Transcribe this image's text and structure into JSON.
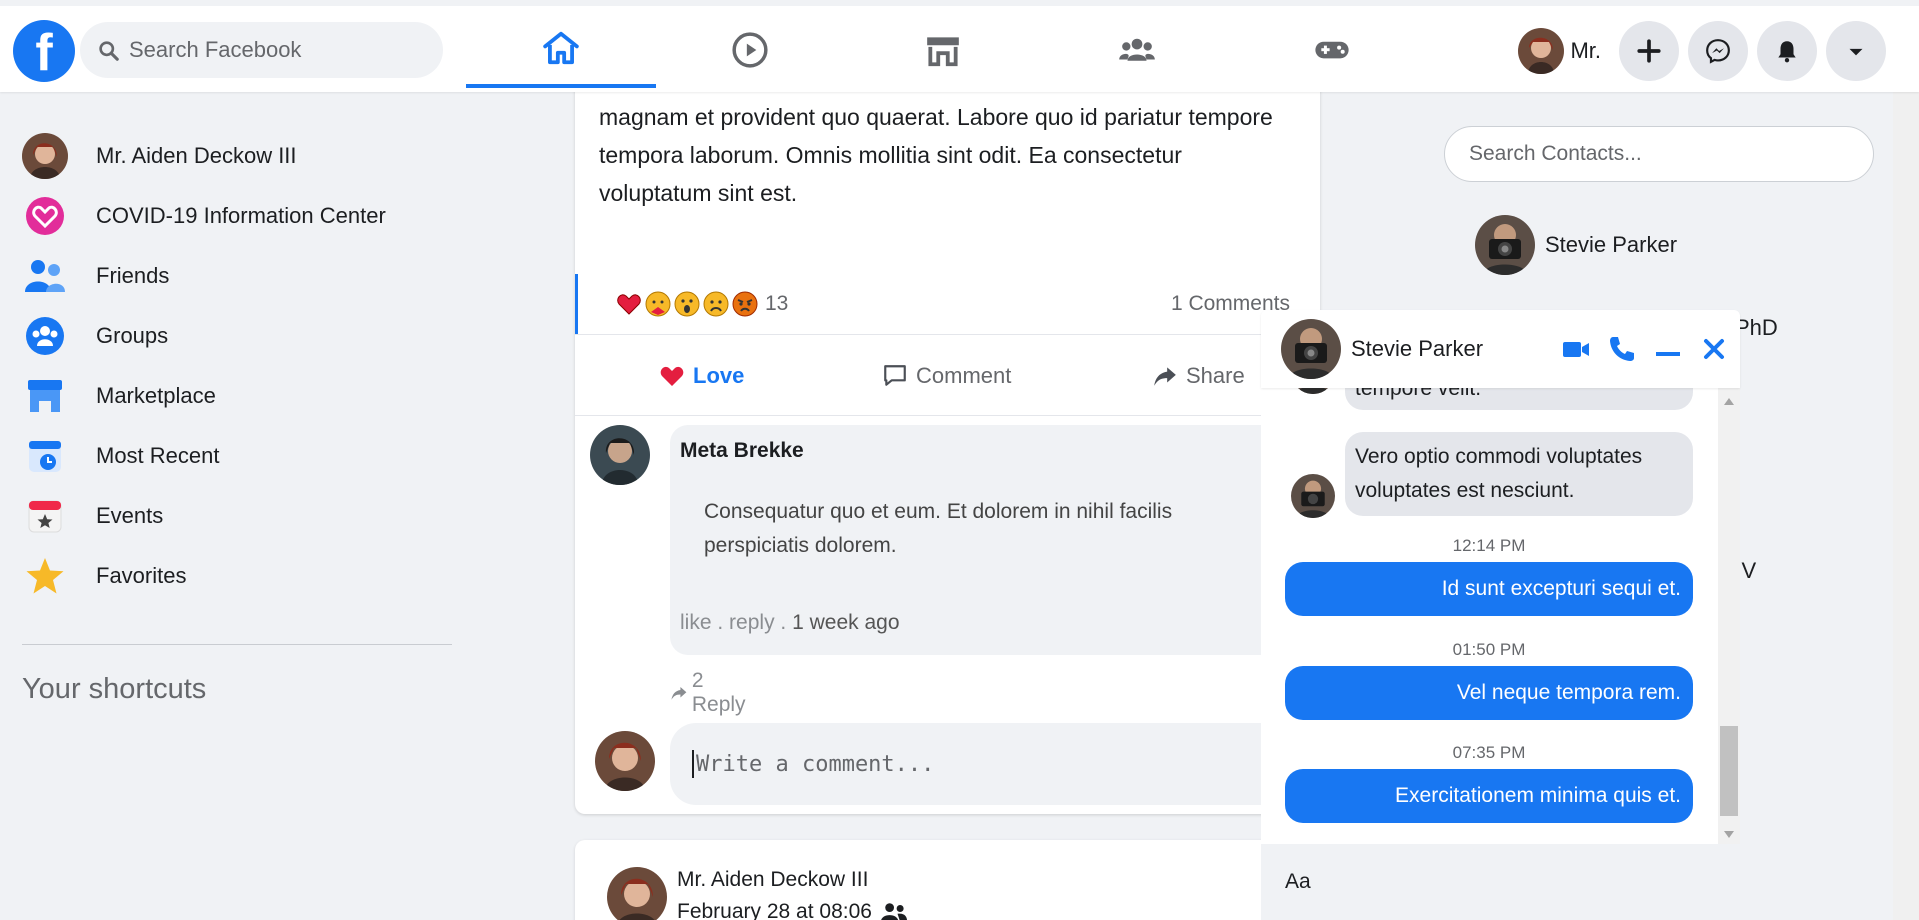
{
  "topbar": {
    "logo_letter": "f",
    "search_placeholder": "Search Facebook",
    "profile_name": "Mr.",
    "nav_tabs": [
      "home-icon",
      "watch-icon",
      "marketplace-icon",
      "groups-icon",
      "gaming-icon"
    ],
    "active_tab": "home",
    "accent_color": "#1877f2"
  },
  "sidebar": {
    "items": [
      {
        "label": "Mr. Aiden Deckow III",
        "icon": "avatar"
      },
      {
        "label": "COVID-19 Information Center",
        "icon": "covid-heart-icon"
      },
      {
        "label": "Friends",
        "icon": "friends-icon"
      },
      {
        "label": "Groups",
        "icon": "groups-icon"
      },
      {
        "label": "Marketplace",
        "icon": "marketplace-icon"
      },
      {
        "label": "Most Recent",
        "icon": "most-recent-icon"
      },
      {
        "label": "Events",
        "icon": "events-icon"
      },
      {
        "label": "Favorites",
        "icon": "star-icon"
      }
    ],
    "shortcuts_title": "Your shortcuts"
  },
  "post": {
    "text": "quo nic. Ut deserunt esse at dolores aut. Laudantium asperiores magnam et provident quo quaerat. Labore quo id pariatur tempore tempora laborum. Omnis mollitia sint odit. Ea consectetur voluptatum sint est.",
    "reaction_count": "13",
    "comments_count": "1 Comments",
    "actions": {
      "love": "Love",
      "comment": "Comment",
      "share": "Share"
    },
    "comment": {
      "author": "Meta Brekke",
      "body": "Consequatur quo et eum. Et dolorem in nihil facilis perspiciatis dolorem.",
      "like": "like",
      "reply": "reply",
      "sep": ".",
      "time": "1 week ago",
      "replies": "2 Reply"
    },
    "write_placeholder": "Write a comment..."
  },
  "post2": {
    "author": "Mr. Aiden Deckow III",
    "date": "February 28 at 08:06"
  },
  "contacts": {
    "search_placeholder": "Search Contacts...",
    "first": "Stevie Parker",
    "frag_phd": "PhD",
    "frag_iv": "n IV"
  },
  "chat": {
    "name": "Stevie Parker",
    "messages": [
      {
        "dir": "in",
        "text": "tempore velit."
      },
      {
        "dir": "in",
        "text": "Vero optio commodi voluptates voluptates est nesciunt."
      },
      {
        "time": "12:14 PM",
        "dir": "out",
        "text": "Id sunt excepturi sequi et."
      },
      {
        "time": "01:50 PM",
        "dir": "out",
        "text": "Vel neque tempora rem."
      },
      {
        "time": "07:35 PM",
        "dir": "out",
        "text": "Exercitationem minima quis et."
      }
    ],
    "input_placeholder": "Aa"
  }
}
